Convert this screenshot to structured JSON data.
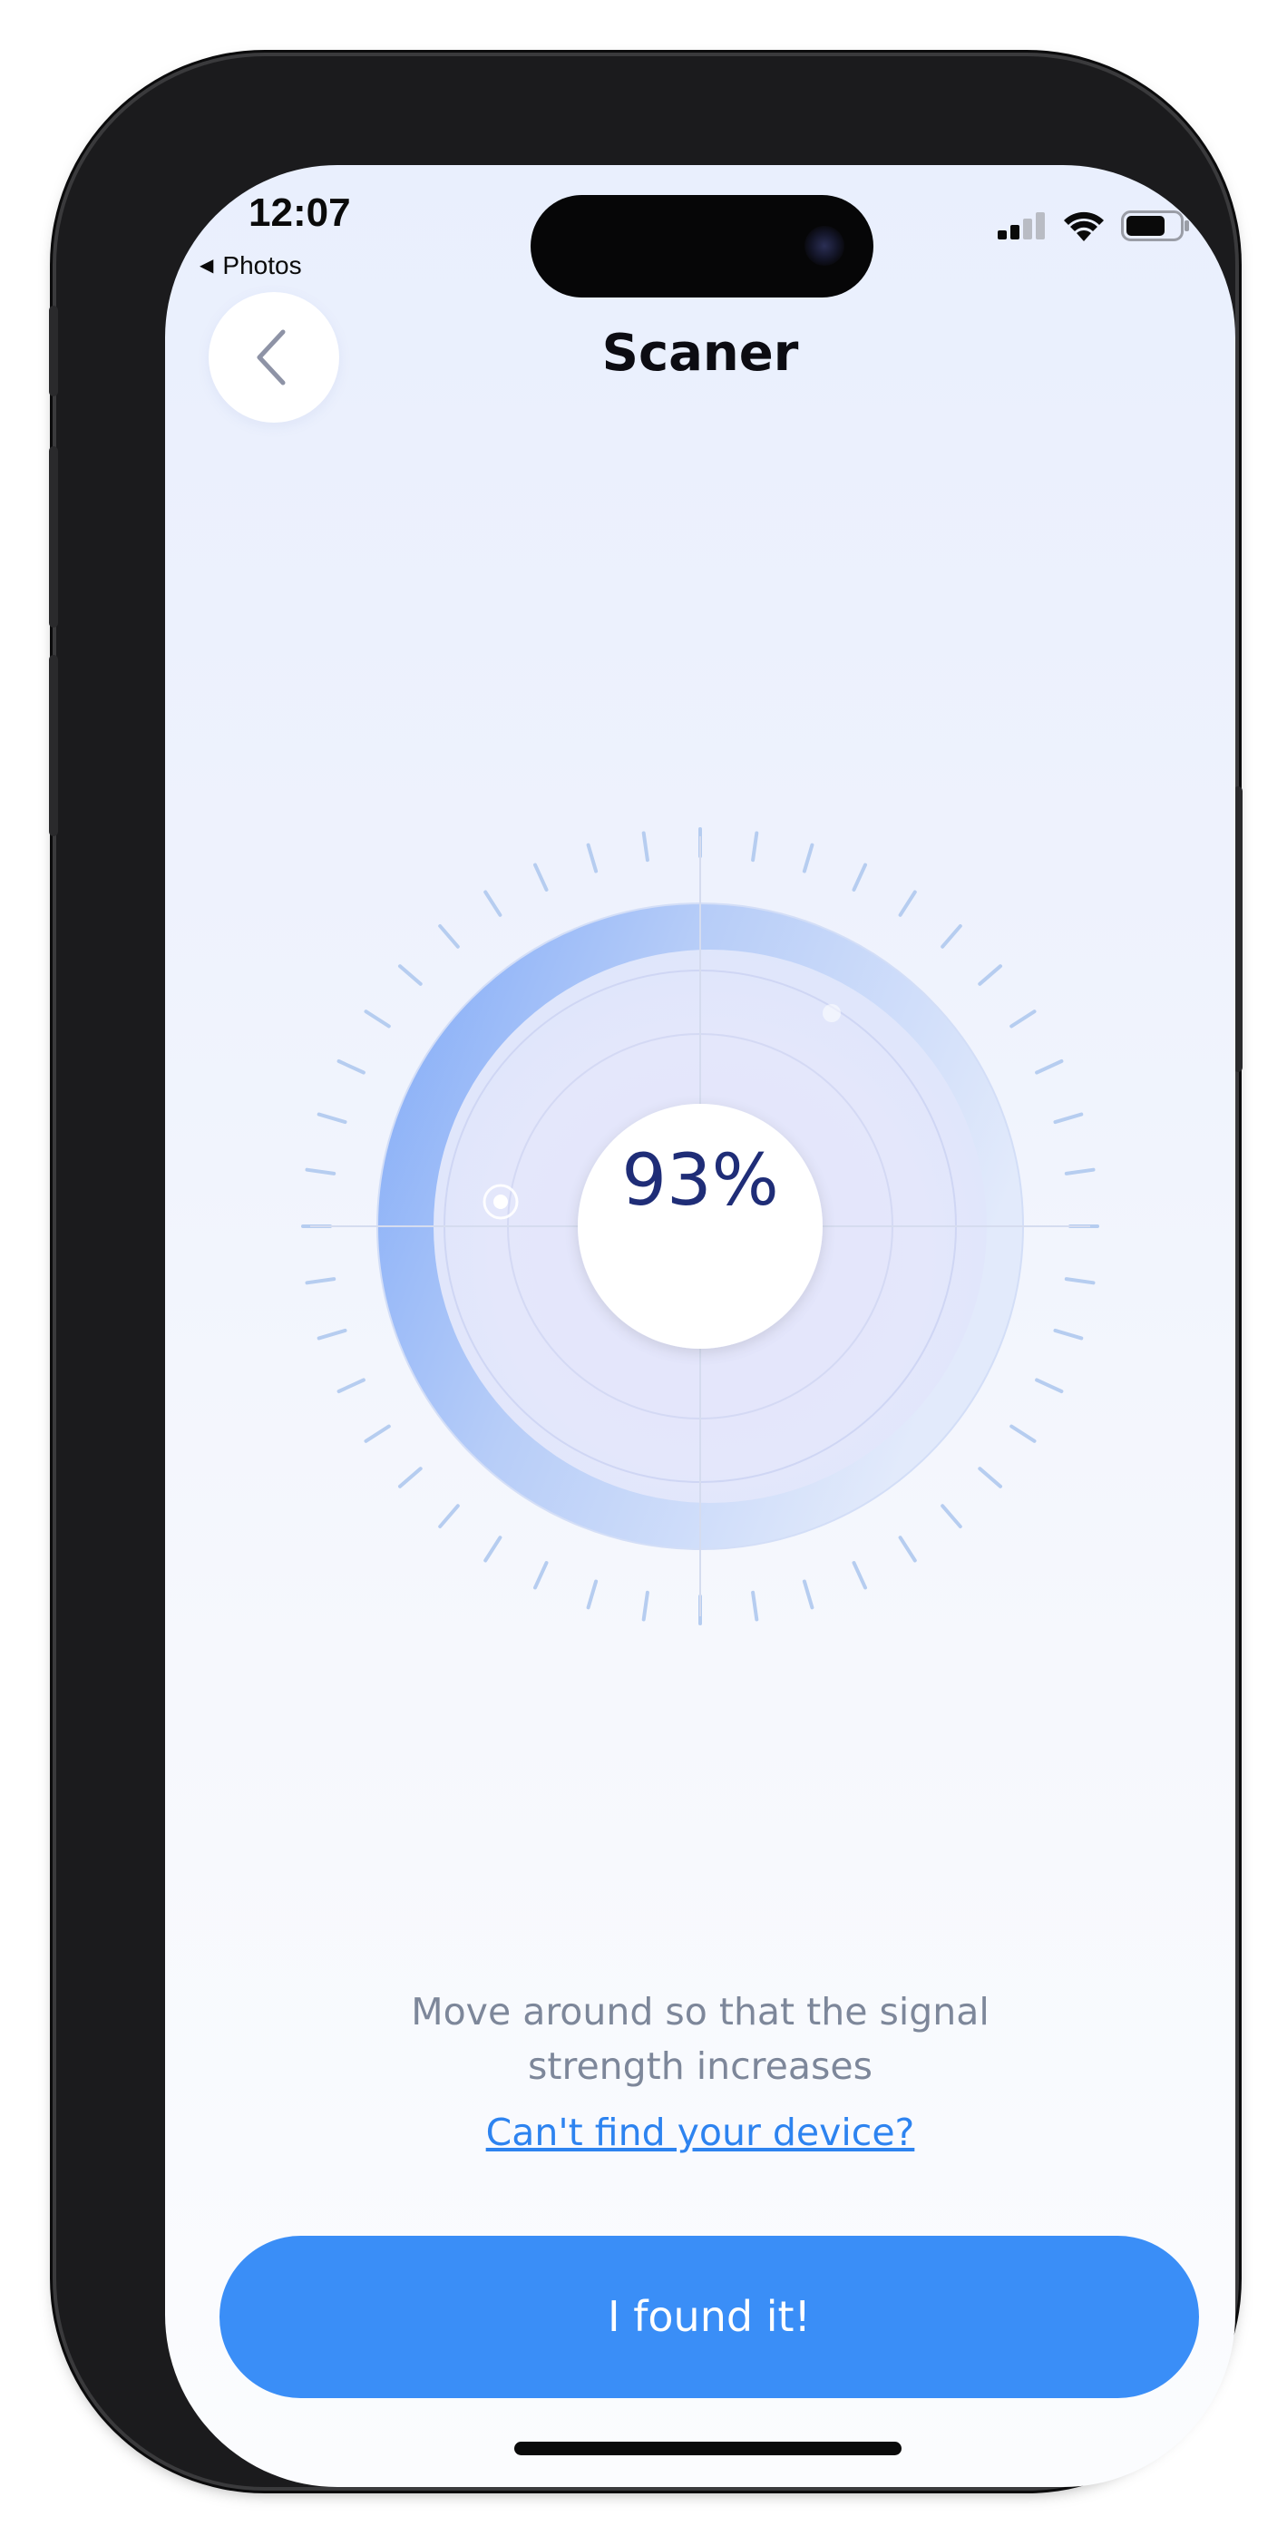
{
  "status_bar": {
    "time": "12:07",
    "back_app": "Photos",
    "icons": [
      "cellular-signal-icon",
      "wifi-icon",
      "battery-icon"
    ]
  },
  "header": {
    "title": "Scaner",
    "back_icon": "chevron-left-icon"
  },
  "scanner": {
    "signal_strength_percent": 93,
    "signal_label": "93%",
    "ring_fill_fraction": 0.93
  },
  "hint_text": {
    "line1": "Move around so that the signal",
    "line2": "strength increases"
  },
  "help_link": "Can't find your device?",
  "primary_button": "I found it!",
  "colors": {
    "accent": "#3a8ef7",
    "link": "#2d83f0",
    "percent_text": "#1f2d77",
    "tick": "#b6cdf0",
    "ring_start": "#8eb3f7",
    "ring_end": "#dde6fb"
  }
}
